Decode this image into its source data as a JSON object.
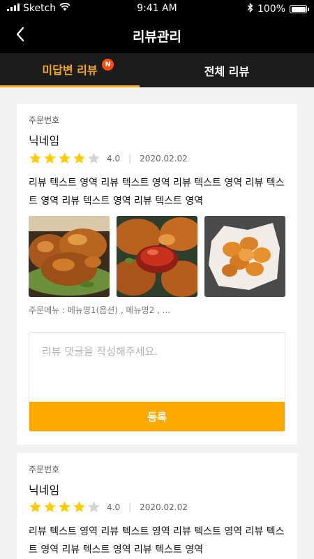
{
  "status_bar": {
    "carrier": "Sketch",
    "time": "9:41 AM",
    "battery": "100%"
  },
  "header": {
    "title": "리뷰관리",
    "back_icon": "chevron-left-icon"
  },
  "tabs": [
    {
      "label": "미답변 리뷰",
      "badge": "N",
      "active": true
    },
    {
      "label": "전체 리뷰",
      "active": false
    }
  ],
  "reviews": [
    {
      "order_label": "주문번호",
      "nickname": "닉네임",
      "rating": 4,
      "rating_text": "4.0",
      "date": "2020.02.02",
      "text": "리뷰 텍스트 영역 리뷰 텍스트 영역 리뷰 텍스트 영역 리뷰 텍스트 영역 리뷰 텍스트 영역 리뷰 텍스트 영역",
      "menu": "주문메뉴 : 메뉴명1(옵션) , 메뉴명2 , ...",
      "comment_placeholder": "리뷰 댓글을 작성해주세요.",
      "submit_label": "등록"
    },
    {
      "order_label": "주문번호",
      "nickname": "닉네임",
      "rating": 4,
      "rating_text": "4.0",
      "date": "2020.02.02",
      "text": "리뷰 텍스트 영역 리뷰 텍스트 영역 리뷰 텍스트 영역 리뷰 텍스트 영역 리뷰 텍스트 영역 리뷰 텍스트 영역"
    }
  ],
  "colors": {
    "accent": "#f5a623",
    "button": "#ffa800",
    "badge": "#ff4c0a",
    "star_on": "#ffcc00",
    "star_off": "#d4d4d4"
  }
}
